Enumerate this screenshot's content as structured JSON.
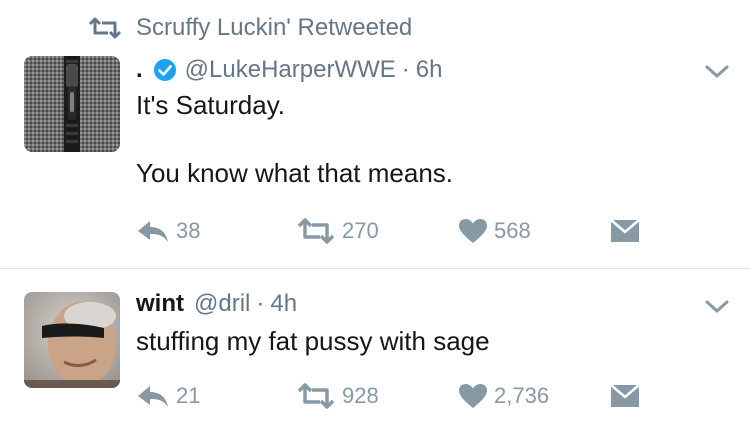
{
  "retweet_banner": {
    "text": "Scruffy Luckin' Retweeted",
    "icon": "retweet-icon"
  },
  "tweets": [
    {
      "display_name": ".",
      "verified": true,
      "handle": "@LukeHarperWWE",
      "separator": "·",
      "time": "6h",
      "text_lines": [
        "It's Saturday.",
        "",
        "You know what that means."
      ],
      "reply_count": "38",
      "retweet_count": "270",
      "like_count": "568"
    },
    {
      "display_name": "wint",
      "verified": false,
      "handle": "@dril",
      "separator": "·",
      "time": "4h",
      "text_lines": [
        "stuffing my fat pussy with sage"
      ],
      "reply_count": "21",
      "retweet_count": "928",
      "like_count": "2,736"
    }
  ],
  "colors": {
    "muted": "#8899a6",
    "verified_blue": "#1da1f2",
    "divider": "#e1e8ed"
  }
}
